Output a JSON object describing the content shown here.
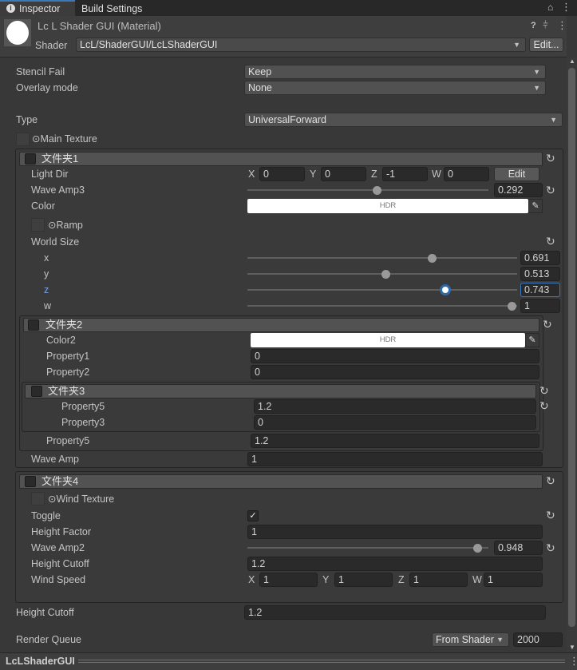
{
  "tabs": [
    {
      "label": "Inspector",
      "active": true
    },
    {
      "label": "Build Settings",
      "active": false
    }
  ],
  "header": {
    "title": "Lc L Shader GUI (Material)",
    "shader_label": "Shader",
    "shader_value": "LcL/ShaderGUI/LcLShaderGUI",
    "edit_label": "Edit..."
  },
  "props": {
    "stencil_fail": {
      "label": "Stencil Fail",
      "value": "Keep"
    },
    "overlay_mode": {
      "label": "Overlay mode",
      "value": "None"
    },
    "type": {
      "label": "Type",
      "value": "UniversalForward"
    },
    "main_texture": {
      "label": "⊙Main Texture"
    },
    "height_cutoff": {
      "label": "Height Cutoff",
      "value": "1.2"
    },
    "render_queue": {
      "label": "Render Queue",
      "mode": "From Shader",
      "value": "2000"
    }
  },
  "group1": {
    "title": "文件夹1",
    "light_dir": {
      "label": "Light Dir",
      "x": "0",
      "y": "0",
      "z": "-1",
      "w": "0",
      "edit": "Edit"
    },
    "wave_amp3": {
      "label": "Wave Amp3",
      "value": "0.292"
    },
    "color": {
      "label": "Color",
      "hdr": "HDR"
    },
    "ramp": {
      "label": "⊙Ramp"
    },
    "world_size": {
      "label": "World Size",
      "x": {
        "label": "x",
        "value": "0.691"
      },
      "y": {
        "label": "y",
        "value": "0.513"
      },
      "z": {
        "label": "z",
        "value": "0.743"
      },
      "w": {
        "label": "w",
        "value": "1"
      }
    },
    "wave_amp": {
      "label": "Wave Amp",
      "value": "1"
    }
  },
  "group2": {
    "title": "文件夹2",
    "color2": {
      "label": "Color2",
      "hdr": "HDR"
    },
    "property1": {
      "label": "Property1",
      "value": "0"
    },
    "property2": {
      "label": "Property2",
      "value": "0"
    },
    "property5": {
      "label": "Property5",
      "value": "1.2"
    }
  },
  "group3": {
    "title": "文件夹3",
    "property5": {
      "label": "Property5",
      "value": "1.2"
    },
    "property3": {
      "label": "Property3",
      "value": "0"
    }
  },
  "group4": {
    "title": "文件夹4",
    "wind_texture": {
      "label": "⊙Wind Texture"
    },
    "toggle": {
      "label": "Toggle",
      "checked": true
    },
    "height_factor": {
      "label": "Height Factor",
      "value": "1"
    },
    "wave_amp2": {
      "label": "Wave Amp2",
      "value": "0.948"
    },
    "height_cutoff": {
      "label": "Height Cutoff",
      "value": "1.2"
    },
    "wind_speed": {
      "label": "Wind Speed",
      "x": "1",
      "y": "1",
      "z": "1",
      "w": "1"
    }
  },
  "axis": {
    "x": "X",
    "y": "Y",
    "z": "Z",
    "w": "W"
  },
  "footer": {
    "title": "LcLShaderGUI"
  },
  "colors": {
    "focus": "#3a79bb",
    "bg": "#383838"
  }
}
